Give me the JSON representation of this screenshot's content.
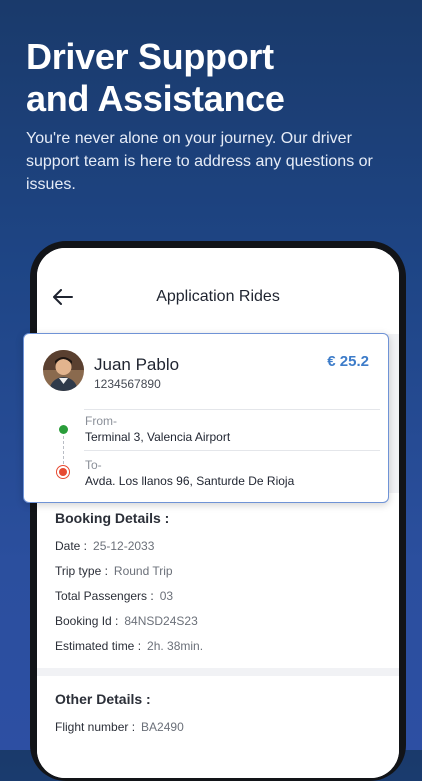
{
  "hero": {
    "title_line1": "Driver Support",
    "title_line2": "and Assistance",
    "subtitle": "You're never alone on your journey. Our driver support team is here to address any questions or issues."
  },
  "appbar": {
    "title": "Application Rides",
    "back_icon": "arrow-left-icon"
  },
  "ride_card": {
    "name": "Juan Pablo",
    "phone": "1234567890",
    "price": "€ 25.2",
    "from_label": "From-",
    "from_value": "Terminal 3, Valencia Airport",
    "to_label": "To-",
    "to_value": "Avda. Los llanos 96, Santurde De Rioja",
    "colors": {
      "from": "#2a9d3a",
      "to": "#e64a32",
      "price": "#3d7cc9"
    }
  },
  "booking": {
    "title": "Booking Details :",
    "rows": [
      {
        "label": "Date :",
        "value": "25-12-2033"
      },
      {
        "label": "Trip type :",
        "value": "Round Trip"
      },
      {
        "label": "Total Passengers :",
        "value": "03"
      },
      {
        "label": "Booking Id :",
        "value": "84NSD24S23"
      },
      {
        "label": "Estimated time :",
        "value": "2h. 38min."
      }
    ]
  },
  "other": {
    "title": "Other Details :",
    "rows": [
      {
        "label": "Flight number :",
        "value": "BA2490"
      }
    ]
  }
}
